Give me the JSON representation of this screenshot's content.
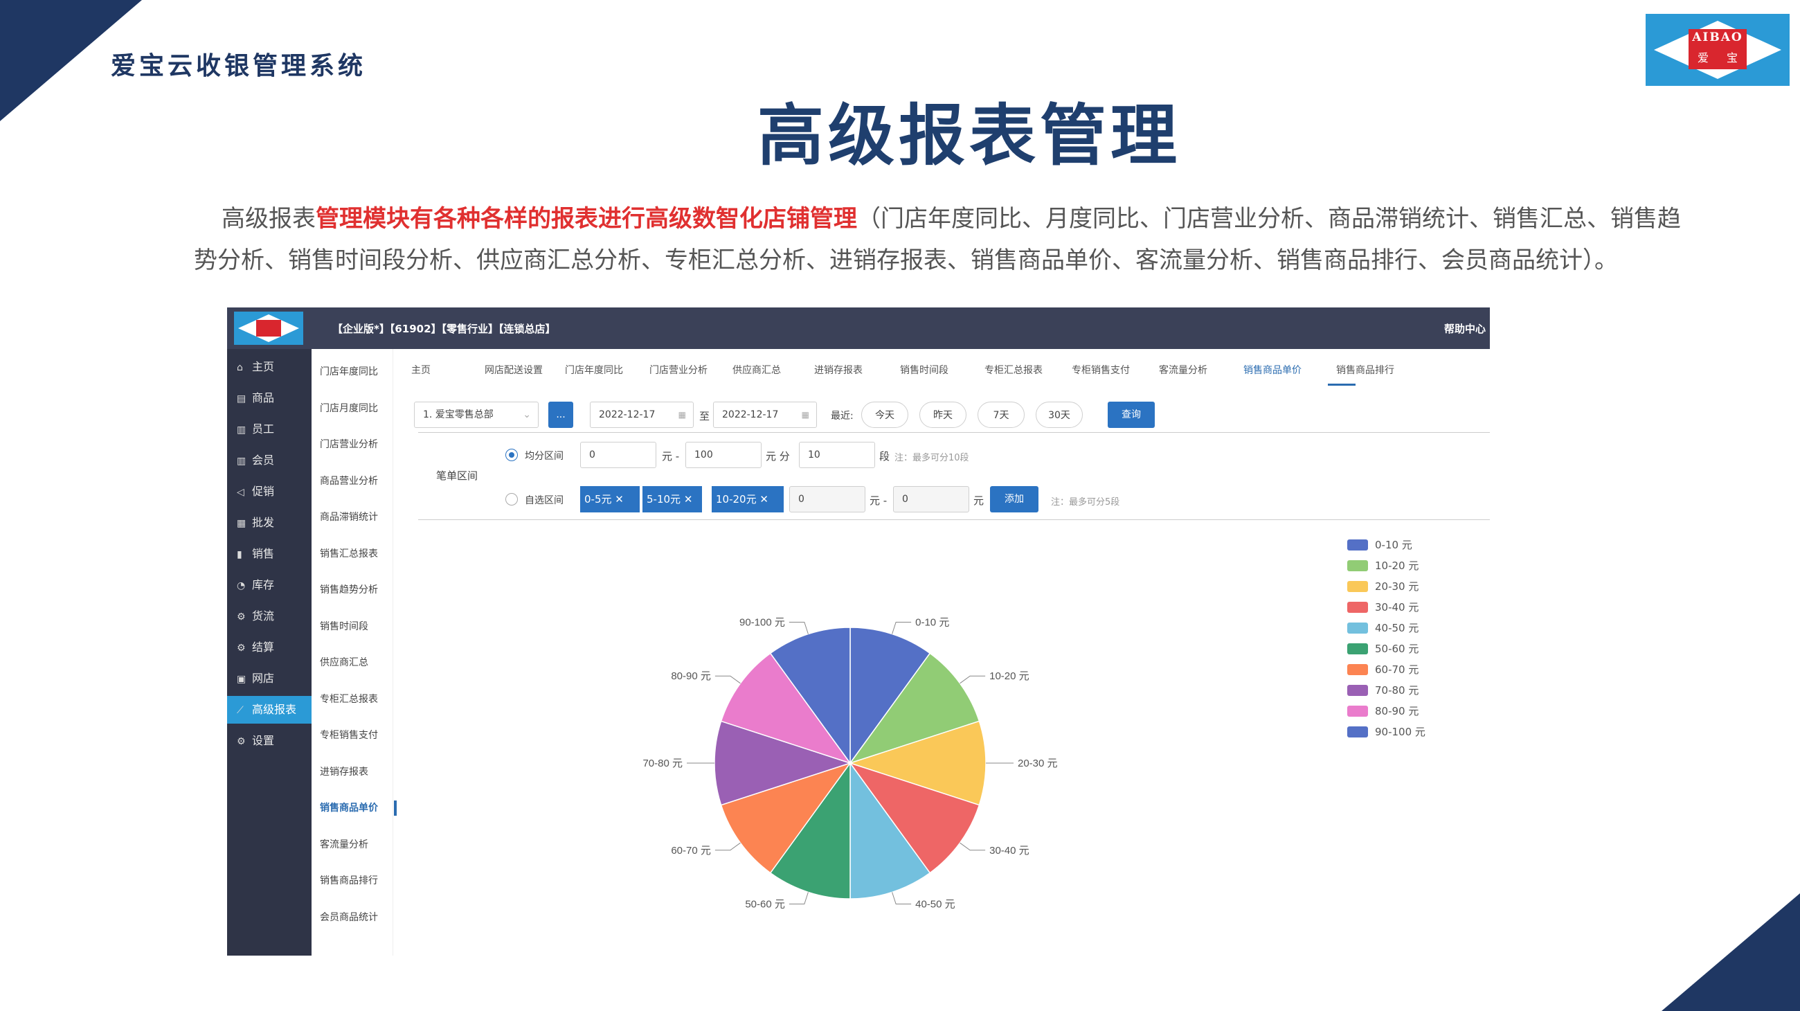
{
  "slide": {
    "brand": "爱宝云收银管理系统",
    "logo_en": "AIBAO",
    "logo_cn": "爱宝",
    "title": "高级报表管理",
    "desc_prefix": "高级报表",
    "desc_highlight": "管理模块有各种各样的报表进行高级数智化店铺管理",
    "desc_rest": "（门店年度同比、月度同比、门店营业分析、商品滞销统计、销售汇总、销售趋势分析、销售时间段分析、供应商汇总分析、专柜汇总分析、进销存报表、销售商品单价、客流量分析、销售商品排行、会员商品统计）。"
  },
  "app": {
    "topbar_info": "【企业版*】【61902】【零售行业】【连锁总店】",
    "help": "帮助中心",
    "sidebar": [
      {
        "label": "主页",
        "icon": "home-icon",
        "glyph": "⌂"
      },
      {
        "label": "商品",
        "icon": "goods-icon",
        "glyph": "▤"
      },
      {
        "label": "员工",
        "icon": "staff-icon",
        "glyph": "▥"
      },
      {
        "label": "会员",
        "icon": "member-icon",
        "glyph": "▥"
      },
      {
        "label": "促销",
        "icon": "promotion-icon",
        "glyph": "◁"
      },
      {
        "label": "批发",
        "icon": "wholesale-icon",
        "glyph": "▦"
      },
      {
        "label": "销售",
        "icon": "sales-icon",
        "glyph": "▮"
      },
      {
        "label": "库存",
        "icon": "stock-icon",
        "glyph": "◔"
      },
      {
        "label": "货流",
        "icon": "logistics-icon",
        "glyph": "⚙"
      },
      {
        "label": "结算",
        "icon": "settlement-icon",
        "glyph": "⚙"
      },
      {
        "label": "网店",
        "icon": "shop-icon",
        "glyph": "▣"
      },
      {
        "label": "高级报表",
        "icon": "report-icon",
        "glyph": "⟋"
      },
      {
        "label": "设置",
        "icon": "settings-icon",
        "glyph": "⚙"
      }
    ],
    "subnav": [
      "门店年度同比",
      "门店月度同比",
      "门店营业分析",
      "商品营业分析",
      "商品滞销统计",
      "销售汇总报表",
      "销售趋势分析",
      "销售时间段",
      "供应商汇总",
      "专柜汇总报表",
      "专柜销售支付",
      "进销存报表",
      "销售商品单价",
      "客流量分析",
      "销售商品排行",
      "会员商品统计"
    ],
    "tabs": [
      "主页",
      "网店配送设置",
      "门店年度同比",
      "门店营业分析",
      "供应商汇总",
      "进销存报表",
      "销售时间段",
      "专柜汇总报表",
      "专柜销售支付",
      "客流量分析",
      "销售商品单价",
      "销售商品排行"
    ],
    "query": {
      "store": "1. 爱宝零售总部",
      "dots": "...",
      "date_from": "2022-12-17",
      "to": "至",
      "date_to": "2022-12-17",
      "recent": "最近:",
      "today": "今天",
      "yesterday": "昨天",
      "d7": "7天",
      "d30": "30天",
      "search": "查询"
    },
    "range": {
      "label": "笔单区间",
      "mode_even": "均分区间",
      "mode_custom": "自选区间",
      "from": "0",
      "yuan_dash": "元 -",
      "to": "100",
      "yuan_split": "元 分",
      "segments": "10",
      "seg_unit": "段",
      "hint_even": "注：最多可分10段",
      "tags": [
        "0-5元",
        "5-10元",
        "10-20元"
      ],
      "custom_from": "0",
      "custom_dash": "元 -",
      "custom_to": "0",
      "custom_unit": "元",
      "add": "添加",
      "hint_custom": "注：最多可分5段"
    }
  },
  "chart_data": {
    "type": "pie",
    "categories": [
      "0-10 元",
      "10-20 元",
      "20-30 元",
      "30-40 元",
      "40-50 元",
      "50-60 元",
      "60-70 元",
      "70-80 元",
      "80-90 元",
      "90-100 元"
    ],
    "values": [
      10,
      10,
      10,
      10,
      10,
      10,
      10,
      10,
      10,
      10
    ],
    "colors": [
      "#5470c6",
      "#91cc75",
      "#fac858",
      "#ee6666",
      "#73c0de",
      "#3ba272",
      "#fc8452",
      "#9a60b4",
      "#ea7ccc",
      "#5470c6"
    ],
    "legend_position": "right"
  }
}
